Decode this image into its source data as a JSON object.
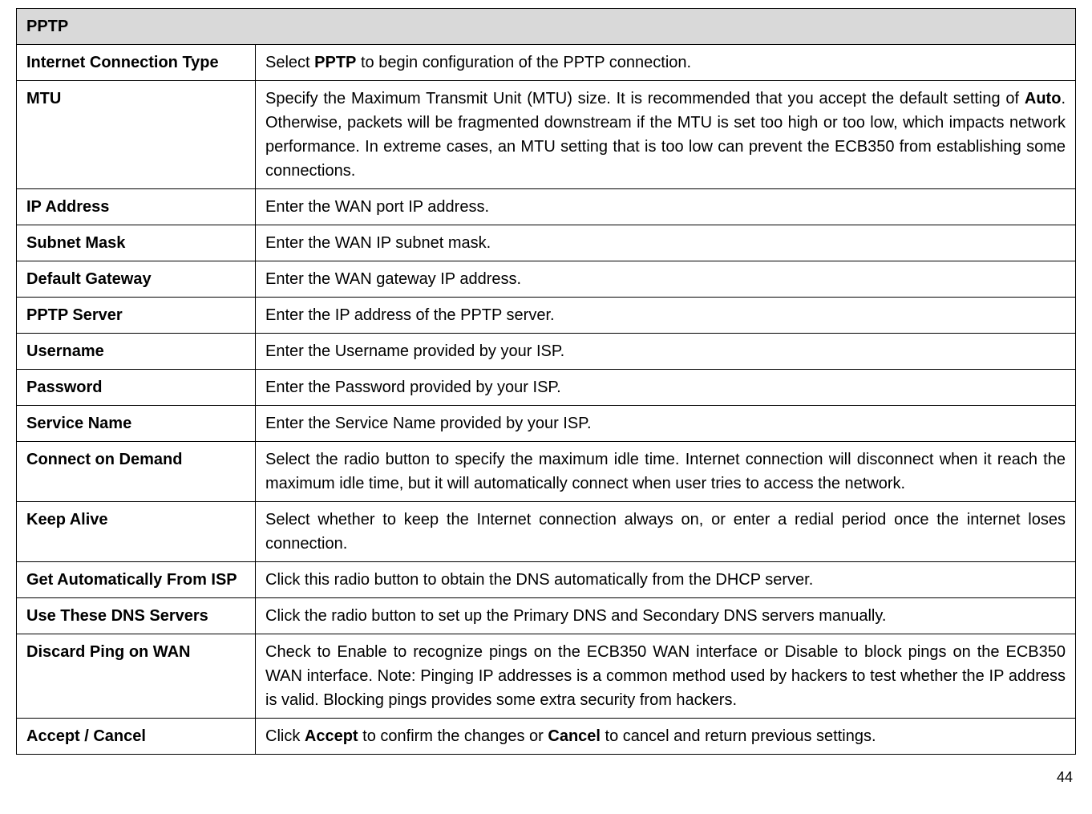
{
  "header": {
    "title": "PPTP"
  },
  "rows": [
    {
      "label": "Internet Connection Type",
      "desc_pre": "Select ",
      "desc_bold1": "PPTP",
      "desc_post": " to begin configuration of the PPTP connection."
    },
    {
      "label": "MTU",
      "desc_pre": "Specify the Maximum Transmit Unit (MTU) size. It is recommended that you accept the default setting of ",
      "desc_bold1": "Auto",
      "desc_post": ". Otherwise, packets will be fragmented downstream if the MTU is set too high or too low, which impacts network performance. In extreme cases, an MTU setting that is too low can prevent the ECB350 from establishing some connections."
    },
    {
      "label": "IP Address",
      "desc": "Enter the WAN port IP address."
    },
    {
      "label": "Subnet Mask",
      "desc": "Enter the WAN IP subnet mask."
    },
    {
      "label": "Default Gateway",
      "desc": "Enter the WAN gateway IP address."
    },
    {
      "label": "PPTP Server",
      "desc": "Enter the IP address of the PPTP server."
    },
    {
      "label": "Username",
      "desc": "Enter the Username provided by your ISP."
    },
    {
      "label": "Password",
      "desc": "Enter the Password provided by your ISP."
    },
    {
      "label": "Service Name",
      "desc": "Enter the Service Name provided by your ISP."
    },
    {
      "label": "Connect on Demand",
      "desc": "Select the radio button to specify the maximum idle time. Internet connection will disconnect when it reach the maximum idle time, but it will automatically connect when user tries to access the network."
    },
    {
      "label": "Keep Alive",
      "desc": "Select whether to keep the Internet connection always on, or enter a redial period once the internet loses connection."
    },
    {
      "label": "Get Automatically From ISP",
      "desc": "Click this radio button to obtain the DNS automatically from the DHCP server."
    },
    {
      "label": "Use These DNS Servers",
      "desc": "Click the radio button to set up the Primary DNS and Secondary DNS servers manually."
    },
    {
      "label": "Discard Ping on WAN",
      "desc": "Check to Enable to recognize pings on the ECB350 WAN interface or Disable to block pings on the ECB350 WAN interface. Note: Pinging IP addresses is a common method used by hackers to test whether the IP address is valid. Blocking pings provides some extra security from hackers."
    },
    {
      "label": "Accept / Cancel",
      "desc_pre": "Click ",
      "desc_bold1": "Accept",
      "desc_mid": " to confirm the changes or ",
      "desc_bold2": "Cancel",
      "desc_post": " to cancel and return previous settings."
    }
  ],
  "page_number": "44"
}
